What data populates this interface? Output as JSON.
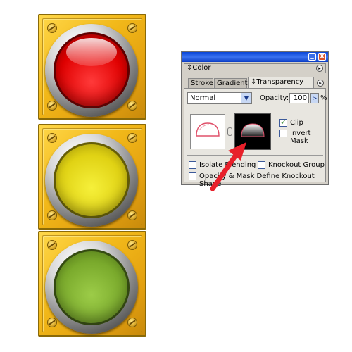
{
  "traffic_light": {
    "lamps": [
      "red",
      "yellow",
      "green"
    ],
    "colors": {
      "housing": "#e8a812",
      "red": "#e00000",
      "yellow": "#e8de1c",
      "green": "#86b43a"
    }
  },
  "panel": {
    "title_buttons": {
      "minimize": "_",
      "close": "x"
    },
    "color_tab": {
      "label": "Color"
    },
    "tabs": [
      {
        "label": "Stroke",
        "active": false
      },
      {
        "label": "Gradient",
        "active": false
      },
      {
        "label": "Transparency",
        "active": true
      }
    ],
    "blend_mode": {
      "value": "Normal"
    },
    "opacity": {
      "label": "Opacity:",
      "value": "100",
      "unit": "%"
    },
    "clip": {
      "label": "Clip",
      "checked": true
    },
    "invert_mask": {
      "label": "Invert Mask",
      "checked": false
    },
    "isolate_blending": {
      "label": "Isolate Blending",
      "checked": false
    },
    "knockout_group": {
      "label": "Knockout Group",
      "checked": false
    },
    "opacity_mask_define": {
      "label": "Opacity & Mask Define Knockout Shape",
      "checked": false
    }
  },
  "annotation": {
    "arrow_color": "#e8202a"
  }
}
